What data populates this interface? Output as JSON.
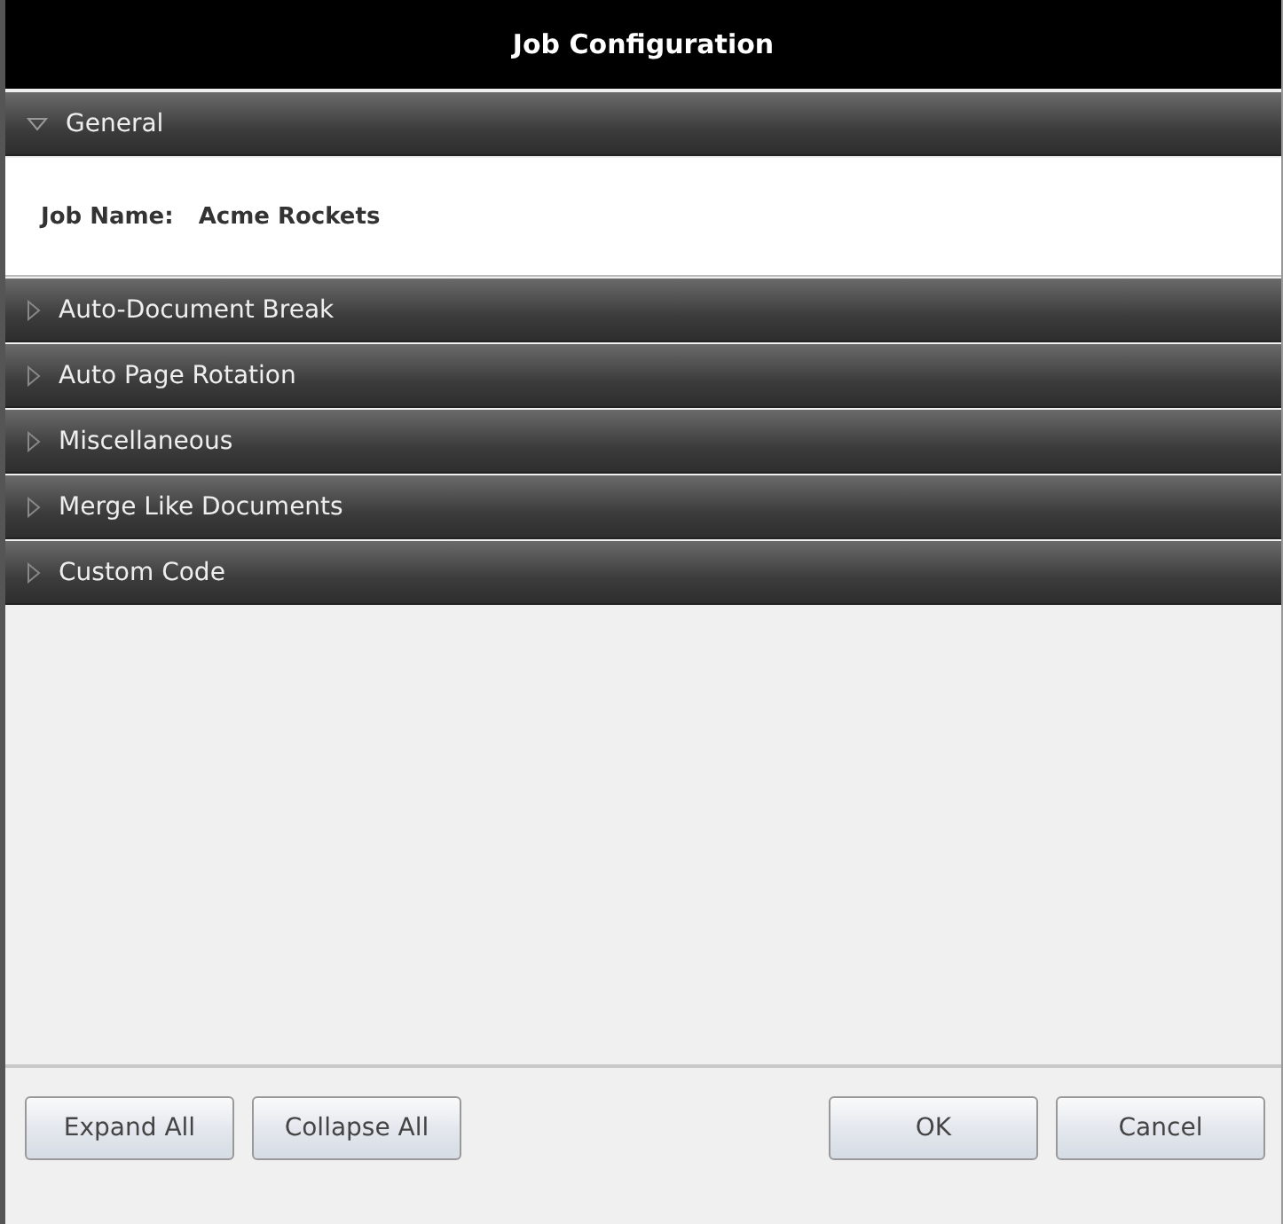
{
  "window": {
    "title": "Job Configuration"
  },
  "sections": [
    {
      "label": "General",
      "expanded": true,
      "fields": [
        {
          "label": "Job Name:",
          "value": "Acme Rockets"
        }
      ]
    },
    {
      "label": "Auto-Document Break",
      "expanded": false
    },
    {
      "label": "Auto Page Rotation",
      "expanded": false
    },
    {
      "label": "Miscellaneous",
      "expanded": false
    },
    {
      "label": "Merge Like Documents",
      "expanded": false
    },
    {
      "label": "Custom Code",
      "expanded": false
    }
  ],
  "buttons_left": [
    "Expand All",
    "Collapse All"
  ],
  "buttons_right": [
    "OK",
    "Cancel"
  ]
}
